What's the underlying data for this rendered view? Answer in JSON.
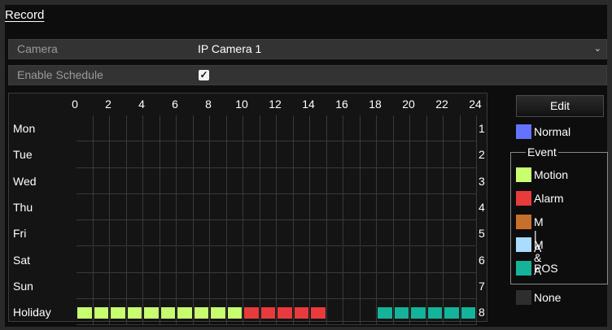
{
  "title": "Record",
  "camera": {
    "label": "Camera",
    "value": "IP Camera 1"
  },
  "enable_schedule": {
    "label": "Enable Schedule",
    "checked": true
  },
  "hours": [
    "0",
    "2",
    "4",
    "6",
    "8",
    "10",
    "12",
    "14",
    "16",
    "18",
    "20",
    "22",
    "24"
  ],
  "days": [
    {
      "name": "Mon",
      "num": "1"
    },
    {
      "name": "Tue",
      "num": "2"
    },
    {
      "name": "Wed",
      "num": "3"
    },
    {
      "name": "Thu",
      "num": "4"
    },
    {
      "name": "Fri",
      "num": "5"
    },
    {
      "name": "Sat",
      "num": "6"
    },
    {
      "name": "Sun",
      "num": "7"
    },
    {
      "name": "Holiday",
      "num": "8"
    }
  ],
  "holiday_schedule": [
    {
      "from_hour": 0,
      "to_hour": 10,
      "type": "motion"
    },
    {
      "from_hour": 10,
      "to_hour": 15,
      "type": "alarm"
    },
    {
      "from_hour": 18,
      "to_hour": 24,
      "type": "pos"
    }
  ],
  "edit_button": "Edit",
  "legend": {
    "normal": {
      "label": "Normal",
      "color": "#6473ff"
    },
    "event_title": "Event",
    "motion": {
      "label": "Motion",
      "color": "#c8ff70"
    },
    "alarm": {
      "label": "Alarm",
      "color": "#e83b3b"
    },
    "m_or_a": {
      "label": "M | A",
      "color": "#c7702c"
    },
    "m_and_a": {
      "label": "M & A",
      "color": "#a9ddff"
    },
    "pos": {
      "label": "POS",
      "color": "#14b39a"
    },
    "none": {
      "label": "None",
      "color": "#2e2e2e"
    }
  }
}
